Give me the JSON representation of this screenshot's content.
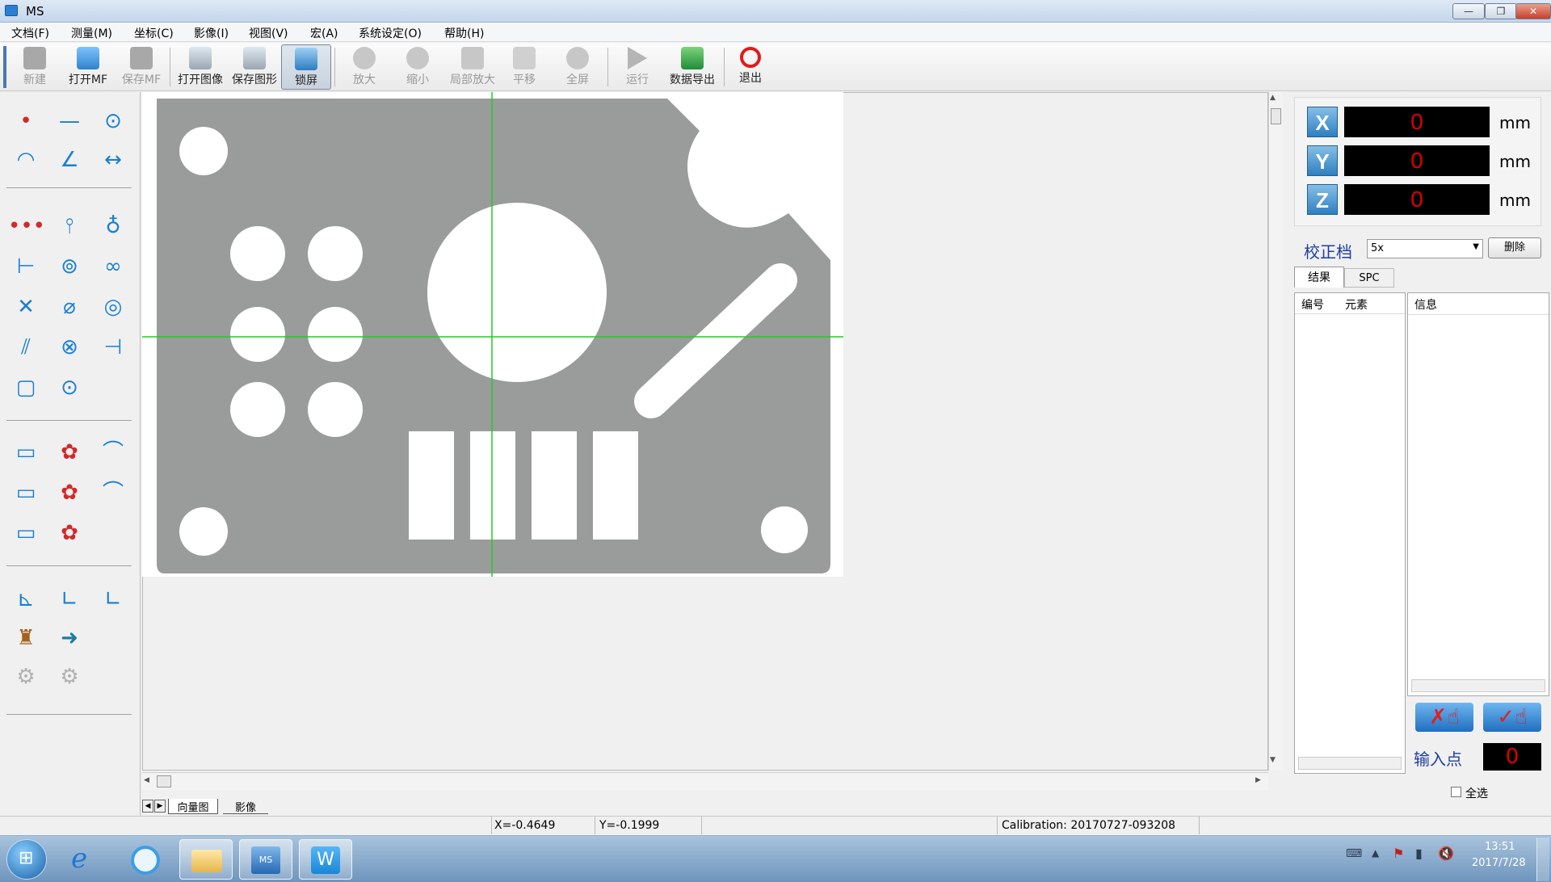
{
  "window": {
    "title": "MS"
  },
  "menu": [
    "文档(F)",
    "测量(M)",
    "坐标(C)",
    "影像(I)",
    "视图(V)",
    "宏(A)",
    "系统设定(O)",
    "帮助(H)"
  ],
  "toolbar": [
    {
      "label": "新建",
      "enabled": false,
      "icon": "new-file-icon"
    },
    {
      "label": "打开MF",
      "enabled": true,
      "icon": "open-folder-icon"
    },
    {
      "label": "保存MF",
      "enabled": false,
      "icon": "save-icon"
    },
    {
      "label": "打开图像",
      "enabled": true,
      "icon": "open-image-icon"
    },
    {
      "label": "保存图形",
      "enabled": true,
      "icon": "save-image-icon"
    },
    {
      "label": "锁屏",
      "enabled": true,
      "selected": true,
      "icon": "lock-screen-icon"
    },
    {
      "label": "放大",
      "enabled": false,
      "icon": "zoom-in-icon"
    },
    {
      "label": "缩小",
      "enabled": false,
      "icon": "zoom-out-icon"
    },
    {
      "label": "局部放大",
      "enabled": false,
      "icon": "region-zoom-icon"
    },
    {
      "label": "平移",
      "enabled": false,
      "icon": "pan-hand-icon"
    },
    {
      "label": "全屏",
      "enabled": false,
      "icon": "fullscreen-icon"
    },
    {
      "label": "运行",
      "enabled": false,
      "icon": "run-icon"
    },
    {
      "label": "数据导出",
      "enabled": true,
      "icon": "excel-export-icon"
    },
    {
      "label": "退出",
      "enabled": true,
      "icon": "power-icon"
    }
  ],
  "dro": {
    "x": {
      "label": "X",
      "value": "0",
      "unit": "mm"
    },
    "y": {
      "label": "Y",
      "value": "0",
      "unit": "mm"
    },
    "z": {
      "label": "Z",
      "value": "0",
      "unit": "mm"
    }
  },
  "calibration": {
    "label": "校正档",
    "selected": "5x",
    "delete_label": "删除"
  },
  "result_tabs": [
    "结果",
    "SPC"
  ],
  "results_table": {
    "col_id": "编号",
    "col_element": "元素",
    "col_info": "信息"
  },
  "input_point": {
    "label": "输入点",
    "value": "0"
  },
  "select_all": "全选",
  "view_tabs": [
    "向量图",
    "影像"
  ],
  "status": {
    "x": "X=-0.4649",
    "y": "Y=-0.1999",
    "calibration": "Calibration: 20170727-093208"
  },
  "taskbar": {
    "time": "13:51",
    "date": "2017/7/28",
    "ms_label": "MS"
  },
  "colors": {
    "axis_blue": "#2f7fc1",
    "dro_red": "#e00000",
    "crosshair": "#22cc22",
    "part_gray": "#9a9b9b"
  }
}
